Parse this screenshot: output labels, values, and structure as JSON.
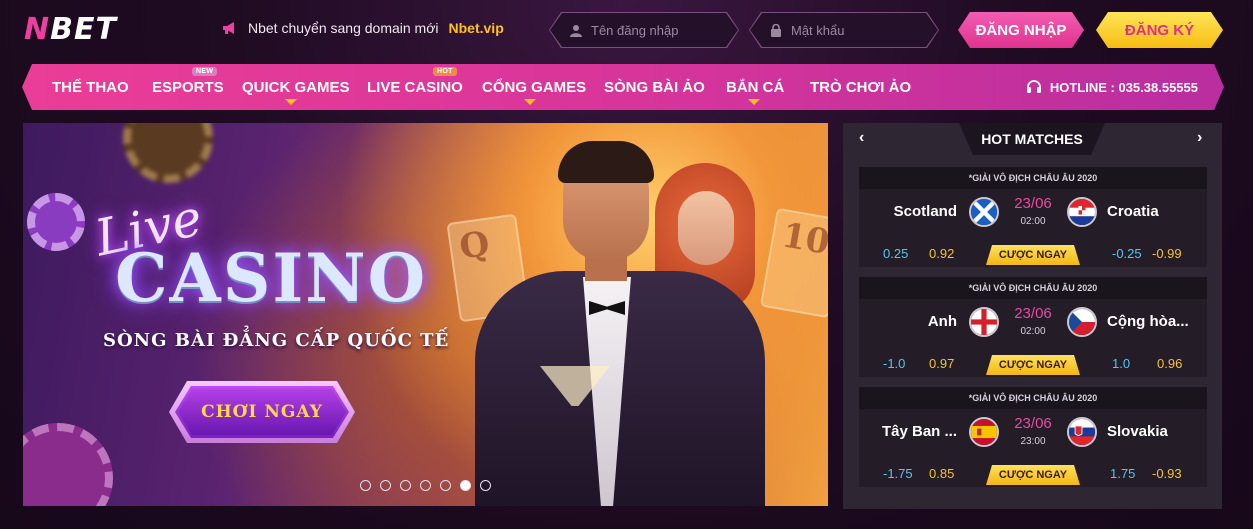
{
  "header": {
    "logo": "NBET",
    "notice_text": "Nbet chuyển sang domain mới",
    "notice_domain": "Nbet.vip",
    "username_placeholder": "Tên đăng nhập",
    "password_placeholder": "Mật khẩu",
    "login_label": "ĐĂNG NHẬP",
    "register_label": "ĐĂNG KÝ"
  },
  "nav": {
    "items": [
      {
        "label": "THỂ THAO"
      },
      {
        "label": "ESPORTS",
        "badge": "NEW"
      },
      {
        "label": "QUICK GAMES"
      },
      {
        "label": "LIVE CASINO",
        "badge": "HOT"
      },
      {
        "label": "CỔNG GAMES"
      },
      {
        "label": "SÒNG BÀI ẢO"
      },
      {
        "label": "BẮN CÁ"
      },
      {
        "label": "TRÒ CHƠI ẢO"
      }
    ],
    "hotline": "HOTLINE : 035.38.55555"
  },
  "banner": {
    "live": "Live",
    "casino": "CASINO",
    "tagline": "SÒNG BÀI ĐẲNG CẤP QUỐC TẾ",
    "cta": "CHƠI NGAY",
    "card_q": "Q",
    "card_10": "10",
    "slides_total": 7,
    "active_slide": 6
  },
  "hot_matches": {
    "title": "HOT MATCHES",
    "prev_icon": "chevron-left-icon",
    "next_icon": "chevron-right-icon",
    "bet_label": "CƯỢC NGAY",
    "matches": [
      {
        "league": "*GIẢI VÔ ĐỊCH CHÂU ÂU 2020",
        "home": "Scotland",
        "away": "Croatia",
        "date": "23/06",
        "time": "02:00",
        "home_handicap": "0.25",
        "home_odds": "0.92",
        "away_handicap": "-0.25",
        "away_odds": "-0.99"
      },
      {
        "league": "*GIẢI VÔ ĐỊCH CHÂU ÂU 2020",
        "home": "Anh",
        "away": "Cộng hòa...",
        "date": "23/06",
        "time": "02:00",
        "home_handicap": "-1.0",
        "home_odds": "0.97",
        "away_handicap": "1.0",
        "away_odds": "0.96"
      },
      {
        "league": "*GIẢI VÔ ĐỊCH CHÂU ÂU 2020",
        "home": "Tây Ban ...",
        "away": "Slovakia",
        "date": "23/06",
        "time": "23:00",
        "home_handicap": "-1.75",
        "home_odds": "0.85",
        "away_handicap": "1.75",
        "away_odds": "-0.93"
      }
    ]
  }
}
